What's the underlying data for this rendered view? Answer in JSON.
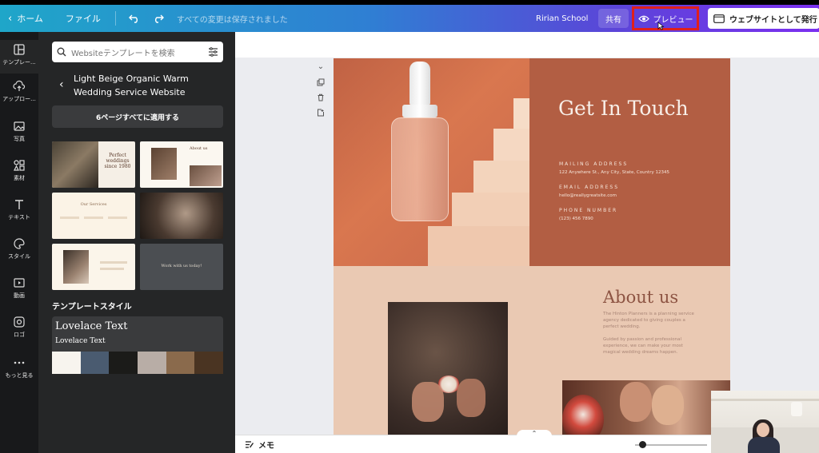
{
  "header": {
    "home_label": "ホーム",
    "file_label": "ファイル",
    "saved_status": "すべての変更は保存されました",
    "team_name": "Ririan School",
    "share_label": "共有",
    "preview_label": "プレビュー",
    "publish_label": "ウェブサイトとして発行"
  },
  "rail": {
    "items": [
      {
        "label": "テンプレー...",
        "icon": "template-icon"
      },
      {
        "label": "アップロー...",
        "icon": "upload-icon"
      },
      {
        "label": "写真",
        "icon": "photo-icon"
      },
      {
        "label": "素材",
        "icon": "elements-icon"
      },
      {
        "label": "テキスト",
        "icon": "text-icon"
      },
      {
        "label": "スタイル",
        "icon": "palette-icon"
      },
      {
        "label": "動画",
        "icon": "video-icon"
      },
      {
        "label": "ロゴ",
        "icon": "logo-icon"
      },
      {
        "label": "もっと見る",
        "icon": "more-icon"
      }
    ]
  },
  "panel": {
    "search_placeholder": "Websiteテンプレートを検索",
    "template_title": "Light Beige Organic Warm Wedding Service Website",
    "apply_all_label": "6ページすべてに適用する",
    "thumbnails": {
      "t1_text": "Perfect weddings since 1980",
      "t2_text": "About us",
      "t3_text": "Our Services",
      "t6_text": "Work with us today!"
    },
    "style_section_label": "テンプレートスタイル",
    "style_font_heading": "Lovelace Text",
    "style_font_body": "Lovelace Text",
    "palette": [
      "#f7f4ee",
      "#4a5b70",
      "#1b1b19",
      "#b8ada6",
      "#8a6a4c",
      "#4a3422"
    ]
  },
  "page": {
    "contact": {
      "title": "Get In Touch",
      "mailing_label": "MAILING ADDRESS",
      "mailing_value": "122 Anywhere St., Any City, State, Country 12345",
      "email_label": "EMAIL ADDRESS",
      "email_value": "hello@reallygreatsite.com",
      "phone_label": "PHONE NUMBER",
      "phone_value": "(123) 456 7890"
    },
    "about": {
      "title": "About us",
      "para1": "The Hinton Planners is a planning service agency dedicated to giving couples a perfect wedding.",
      "para2": "Guided by passion and professional experience, we can make your most magical wedding dreams happen."
    }
  },
  "bottom": {
    "notes_label": "メモ",
    "zoom_level": 0.1
  }
}
